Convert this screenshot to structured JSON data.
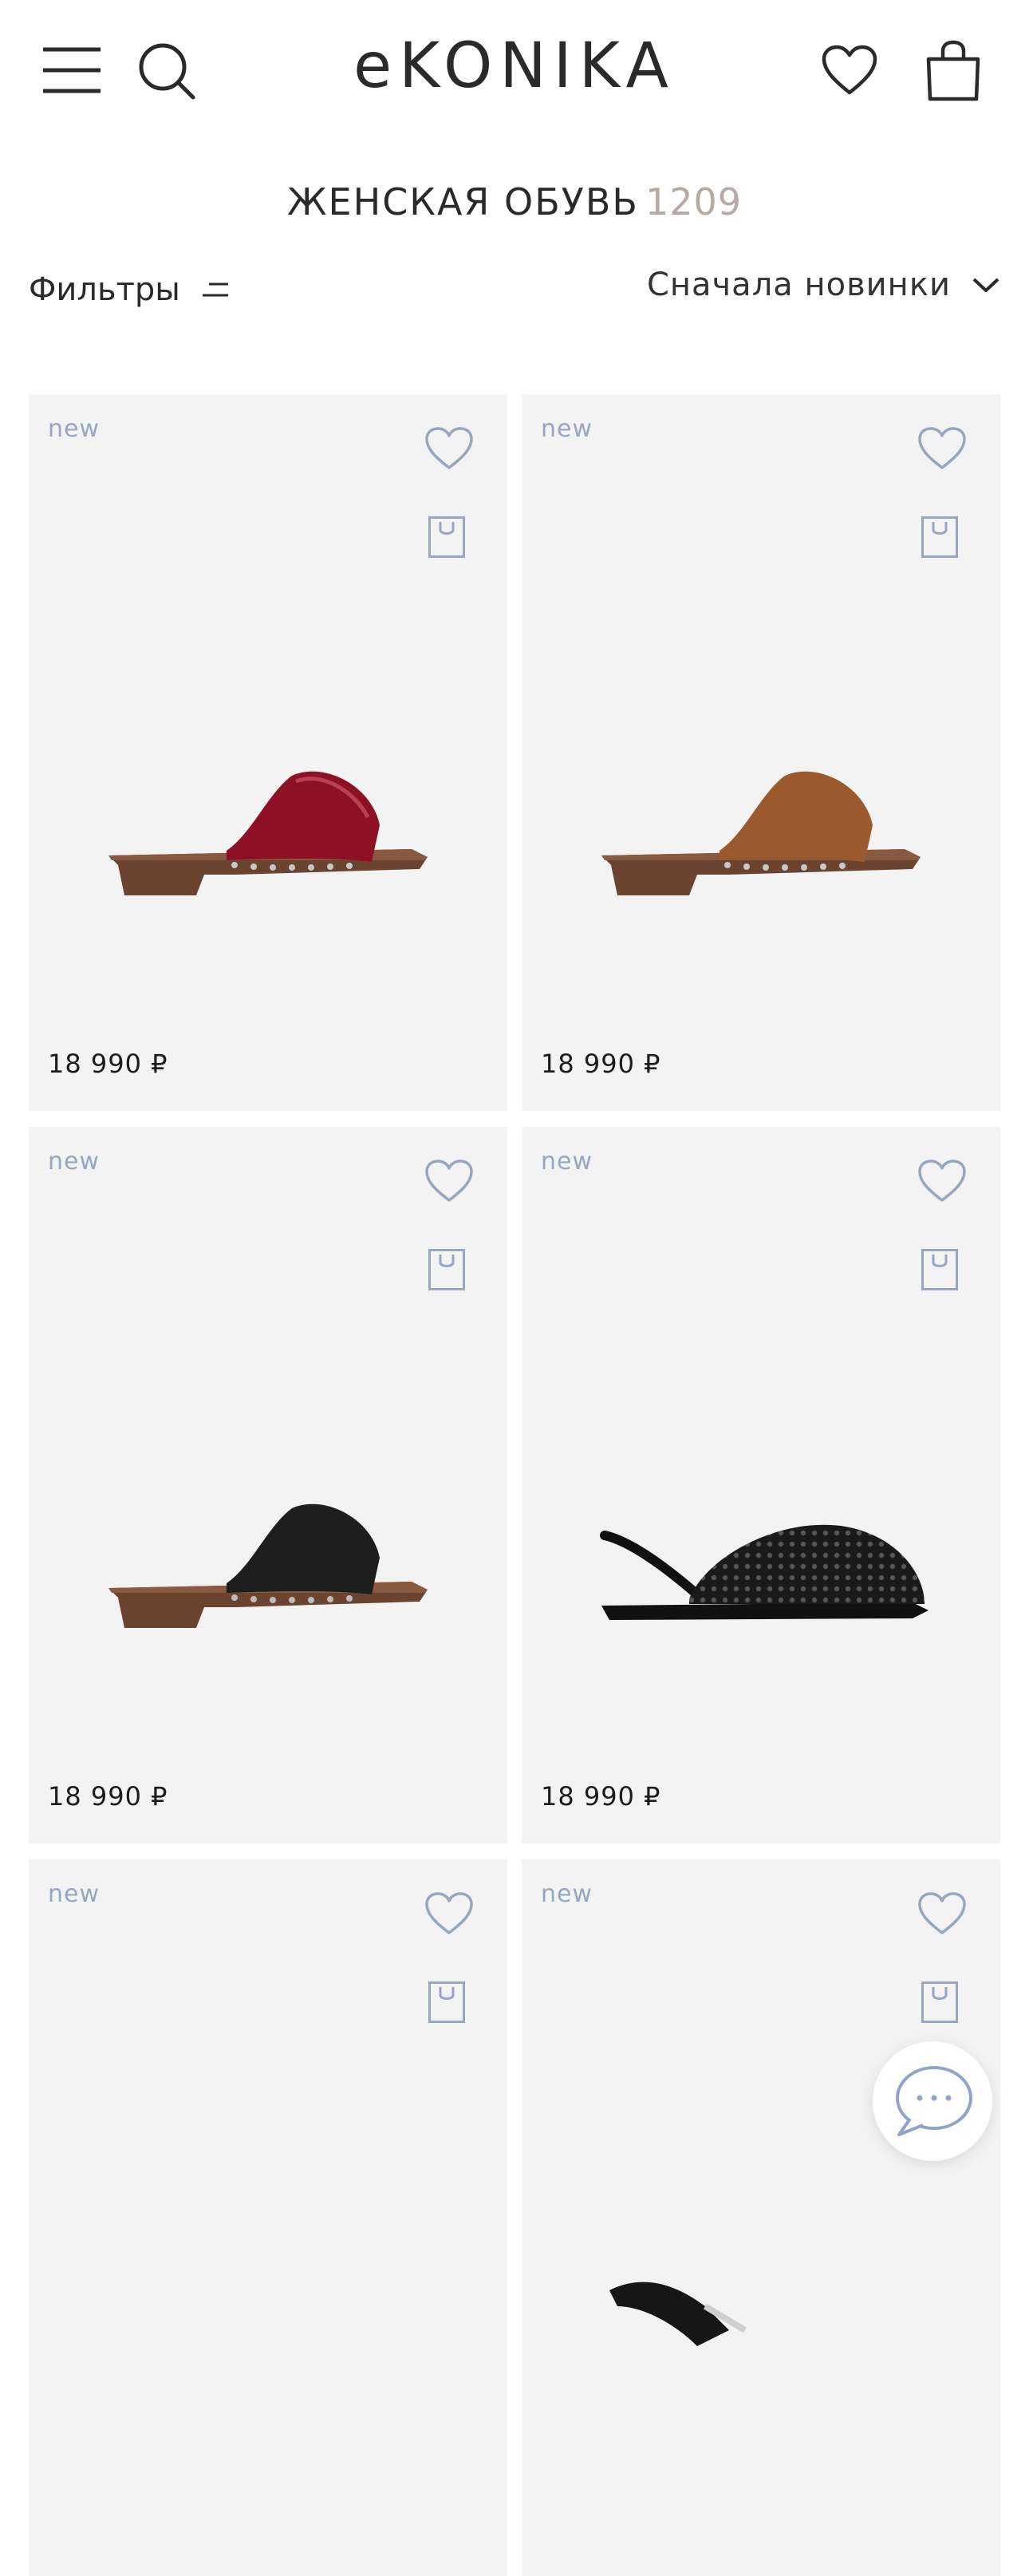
{
  "header": {
    "logo": "eKONIKA",
    "icons": [
      "menu-icon",
      "search-icon",
      "heart-icon",
      "bag-icon"
    ]
  },
  "catalog": {
    "title": "ЖЕНСКАЯ ОБУВЬ",
    "count": "1209",
    "filters_label": "Фильтры",
    "sort_label": "Сначала новинки"
  },
  "colors": {
    "accent_icon": "#98a7c1",
    "count": "#b7a9a4",
    "card_bg": "#f3f3f3"
  },
  "products": [
    {
      "badge": "new",
      "price": "18 990 ₽",
      "shoe": "clog-red-patent"
    },
    {
      "badge": "new",
      "price": "18 990 ₽",
      "shoe": "clog-brown-suede"
    },
    {
      "badge": "new",
      "price": "18 990 ₽",
      "shoe": "clog-black-leather"
    },
    {
      "badge": "new",
      "price": "18 990 ₽",
      "shoe": "woven-slingback-black"
    },
    {
      "badge": "new",
      "price": "",
      "shoe": ""
    },
    {
      "badge": "new",
      "price": "",
      "shoe": "black-partial"
    }
  ],
  "chat": {
    "icon": "chat-bubble-icon"
  }
}
